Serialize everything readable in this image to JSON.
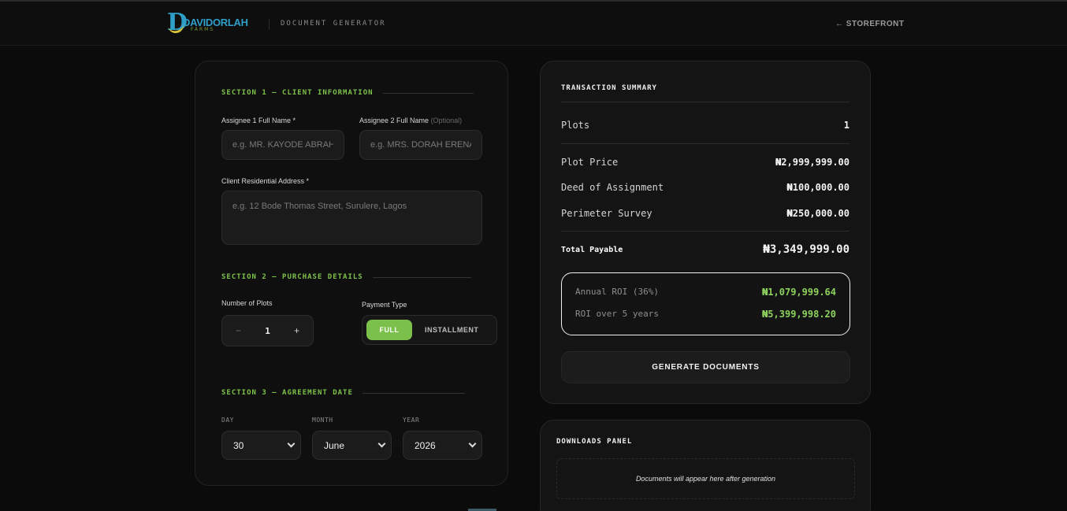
{
  "header": {
    "logo": {
      "name": "DAVIDORLAH",
      "sub": "FARMS",
      "letter": "D"
    },
    "subtitle": "DOCUMENT GENERATOR",
    "storefront_link": "← STOREFRONT"
  },
  "form": {
    "section1": {
      "title": "SECTION 1 — CLIENT INFORMATION",
      "assignee1_label": "Assignee 1 Full Name *",
      "assignee1_placeholder": "e.g. MR. KAYODE ABRAHAM",
      "assignee2_label": "Assignee 2 Full Name",
      "assignee2_optional": "(Optional)",
      "assignee2_placeholder": "e.g. MRS. DORAH ERENA",
      "address_label": "Client Residential Address *",
      "address_placeholder": "e.g. 12 Bode Thomas Street, Surulere, Lagos"
    },
    "section2": {
      "title": "SECTION 2 — PURCHASE DETAILS",
      "plots_label": "Number of Plots",
      "minus": "−",
      "plots_value": "1",
      "plus": "+",
      "payment_label": "Payment Type",
      "payment_full": "FULL",
      "payment_installment": "INSTALLMENT"
    },
    "section3": {
      "title": "SECTION 3 — AGREEMENT DATE",
      "day_label": "DAY",
      "day_value": "30",
      "month_label": "MONTH",
      "month_value": "June",
      "year_label": "YEAR",
      "year_value": "2026"
    }
  },
  "summary": {
    "title": "TRANSACTION SUMMARY",
    "plots_label": "Plots",
    "plots_value": "1",
    "plot_price_label": "Plot Price",
    "plot_price_value": "₦2,999,999.00",
    "deed_label": "Deed of Assignment",
    "deed_value": "₦100,000.00",
    "survey_label": "Perimeter Survey",
    "survey_value": "₦250,000.00",
    "total_label": "Total Payable",
    "total_value": "₦3,349,999.00",
    "roi_annual_label": "Annual ROI (36%)",
    "roi_annual_value": "₦1,079,999.64",
    "roi_5yr_label": "ROI over 5 years",
    "roi_5yr_value": "₦5,399,998.20",
    "generate_button": "GENERATE DOCUMENTS"
  },
  "downloads": {
    "title": "DOWNLOADS PANEL",
    "empty_text": "Documents will appear here after generation"
  },
  "colors": {
    "accent_green": "#7ac04a",
    "logo_blue": "#2f9ec8",
    "background": "#0b0b0b"
  }
}
